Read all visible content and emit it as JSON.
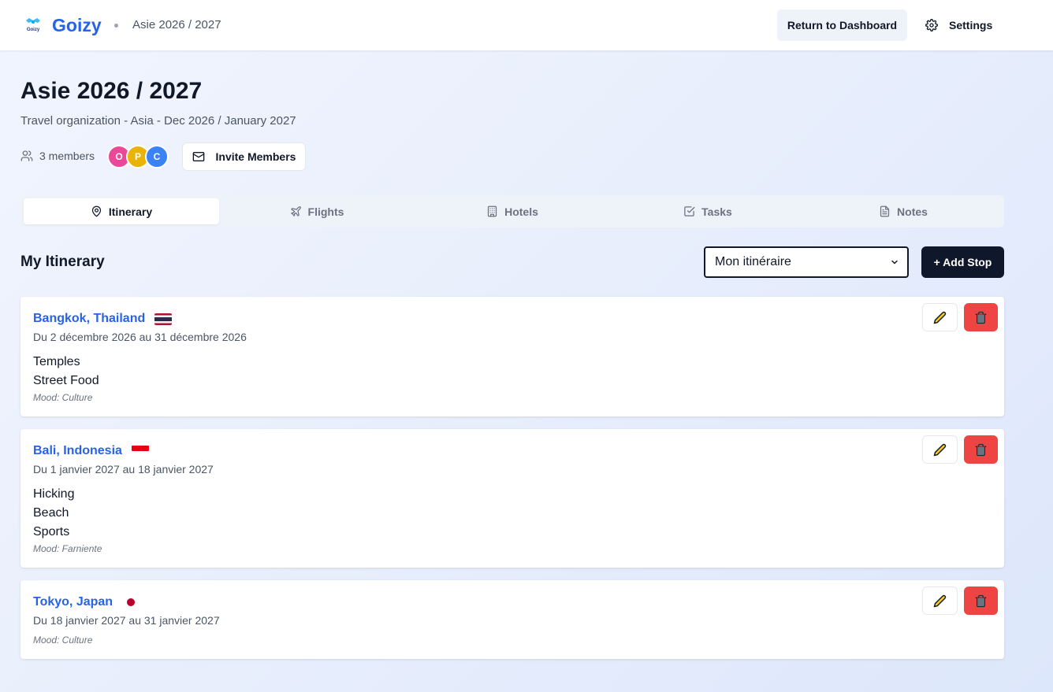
{
  "header": {
    "app_name": "Goizy",
    "logo_caption": "Goizy",
    "breadcrumb": "Asie 2026 / 2027",
    "dashboard_label": "Return to Dashboard",
    "settings_label": "Settings"
  },
  "trip": {
    "title": "Asie 2026 / 2027",
    "subtitle": "Travel organization - Asia - Dec 2026 / January 2027",
    "members_label": "3 members",
    "avatars": [
      {
        "initial": "O",
        "color": "#ec4899"
      },
      {
        "initial": "P",
        "color": "#eab308"
      },
      {
        "initial": "C",
        "color": "#3b82f6"
      }
    ],
    "invite_label": "Invite Members"
  },
  "tabs": [
    {
      "label": "Itinerary",
      "icon": "map-pin-icon",
      "active": true
    },
    {
      "label": "Flights",
      "icon": "plane-icon",
      "active": false
    },
    {
      "label": "Hotels",
      "icon": "building-icon",
      "active": false
    },
    {
      "label": "Tasks",
      "icon": "check-square-icon",
      "active": false
    },
    {
      "label": "Notes",
      "icon": "file-text-icon",
      "active": false
    }
  ],
  "itinerary": {
    "section_title": "My Itinerary",
    "selected_itinerary": "Mon itinéraire",
    "add_stop_label": "+ Add Stop",
    "stops": [
      {
        "city": "Bangkok, Thailand",
        "flag": "thailand",
        "dates": "Du 2 décembre 2026 au 31 décembre 2026",
        "activities": [
          "Temples",
          "Street Food"
        ],
        "mood": "Mood: Culture"
      },
      {
        "city": "Bali, Indonesia",
        "flag": "indonesia",
        "dates": "Du 1 janvier 2027 au 18 janvier 2027",
        "activities": [
          "Hicking",
          "Beach",
          "Sports"
        ],
        "mood": "Mood: Farniente"
      },
      {
        "city": "Tokyo, Japan",
        "flag": "japan",
        "dates": "Du 18 janvier 2027 au 31 janvier 2027",
        "activities": [],
        "mood": "Mood: Culture"
      }
    ]
  },
  "colors": {
    "brand": "#2563eb",
    "primary_button": "#0f172a",
    "danger": "#ef4444",
    "edit_icon": "#ca8a04"
  }
}
